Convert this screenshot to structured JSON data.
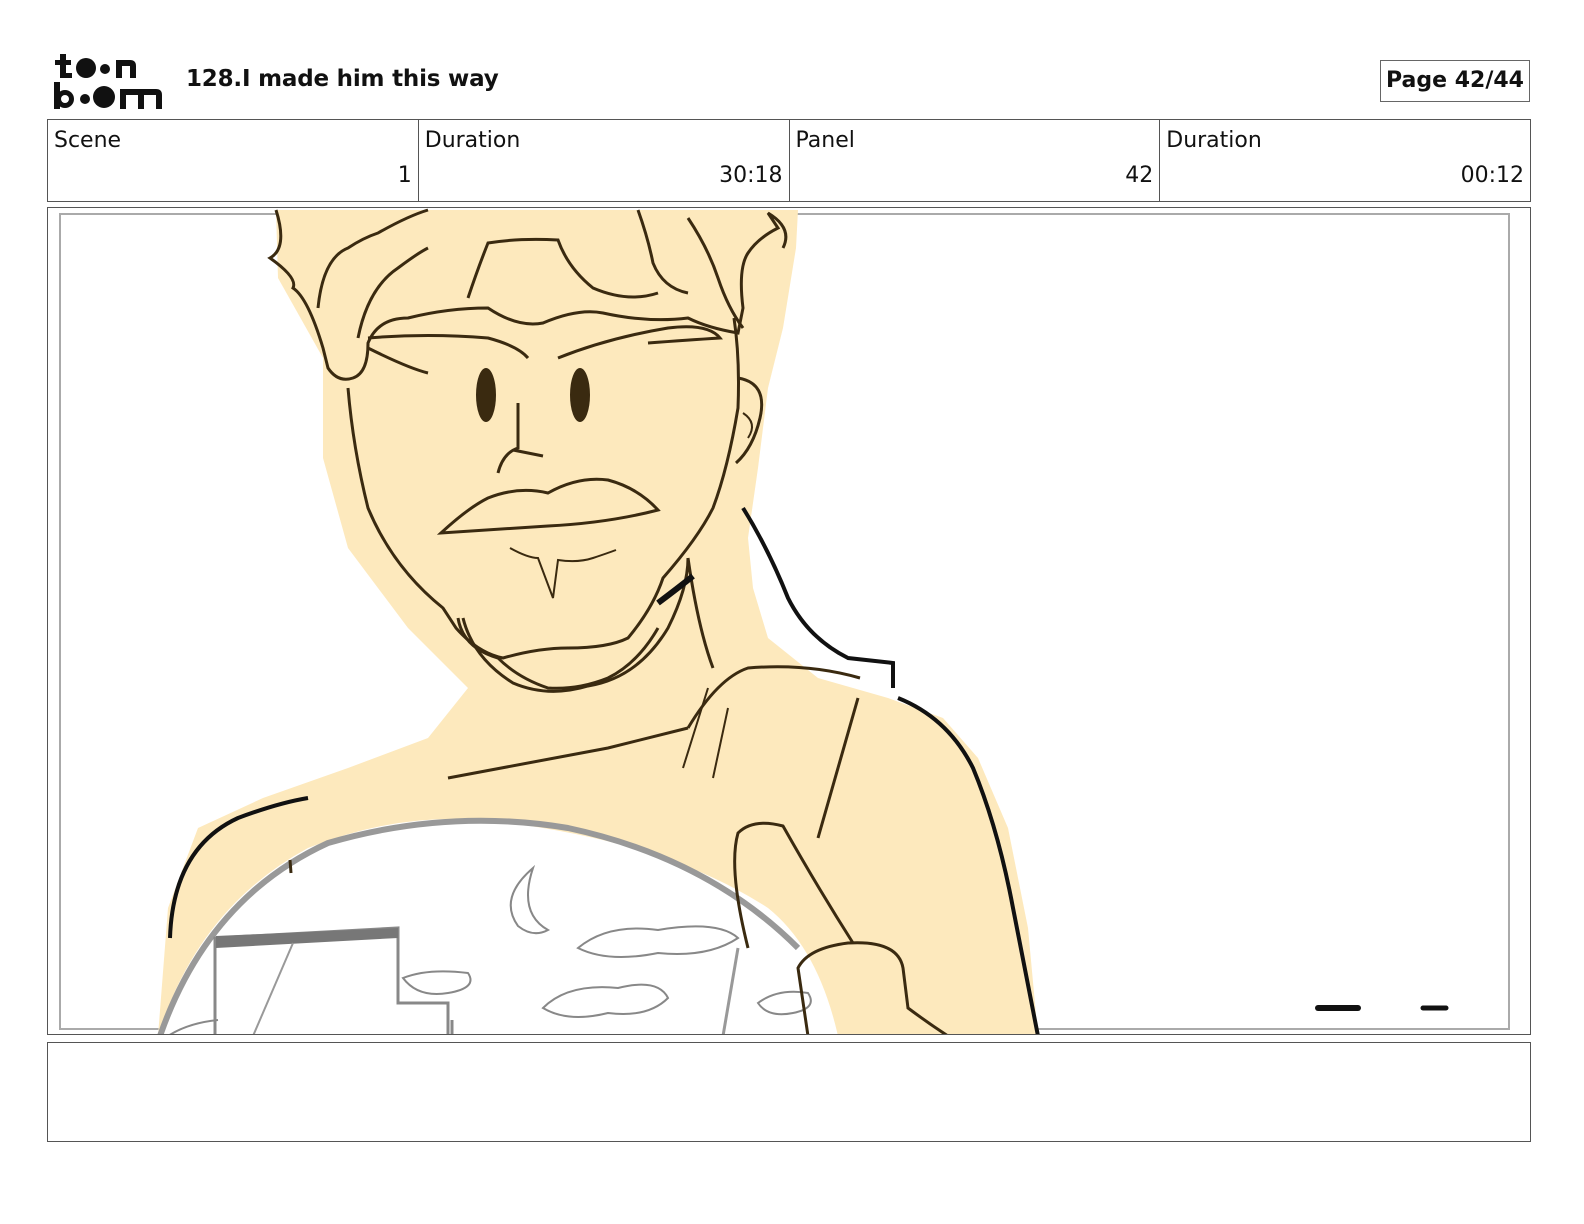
{
  "header": {
    "logo_text": "toon boom",
    "title": "128.I made him this way",
    "page_label": "Page 42/44"
  },
  "info": {
    "scene_label": "Scene",
    "scene_value": "1",
    "scene_duration_label": "Duration",
    "scene_duration_value": "30:18",
    "panel_label": "Panel",
    "panel_value": "42",
    "panel_duration_label": "Duration",
    "panel_duration_value": "00:12"
  },
  "colors": {
    "skin_fill": "#fde9bd",
    "line": "#3a2a10",
    "frame": "#555555"
  },
  "notes": {
    "text": ""
  }
}
